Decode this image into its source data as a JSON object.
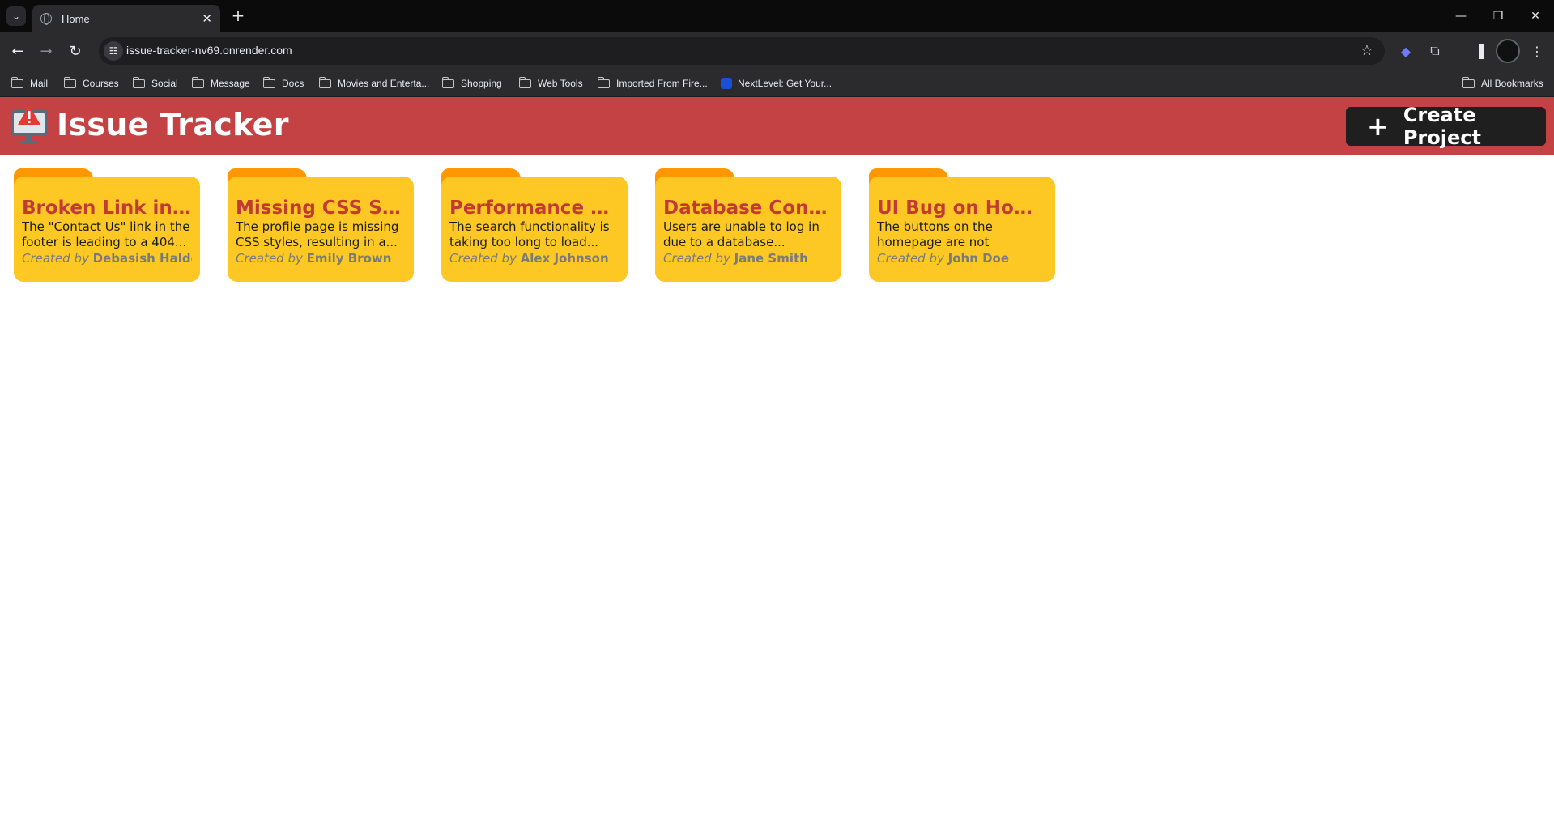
{
  "browser": {
    "tab_title": "Home",
    "url": "issue-tracker-nv69.onrender.com",
    "bookmarks": [
      "Mail",
      "Courses",
      "Social",
      "Message",
      "Docs",
      "Movies and Enterta...",
      "Shopping",
      "Web Tools",
      "Imported From Fire...",
      "NextLevel: Get Your..."
    ],
    "all_bookmarks": "All Bookmarks"
  },
  "header": {
    "title": "Issue Tracker",
    "create_label": "Create Project",
    "accent_color": "#c44244"
  },
  "created_by_prefix": "Created by",
  "issues": [
    {
      "title": "Broken Link in F...",
      "description": "The \"Contact Us\" link in the footer is leading to a 404...",
      "author": "Debasish Halder"
    },
    {
      "title": "Missing CSS Style...",
      "description": "The profile page is missing CSS styles, resulting in a...",
      "author": "Emily Brown"
    },
    {
      "title": "Performance Deg...",
      "description": "The search functionality is taking too long to load...",
      "author": "Alex Johnson"
    },
    {
      "title": "Database Connec...",
      "description": "Users are unable to log in due to a database...",
      "author": "Jane Smith"
    },
    {
      "title": "UI Bug on Homep...",
      "description": "The buttons on the homepage are not aligned...",
      "author": "John Doe"
    }
  ]
}
